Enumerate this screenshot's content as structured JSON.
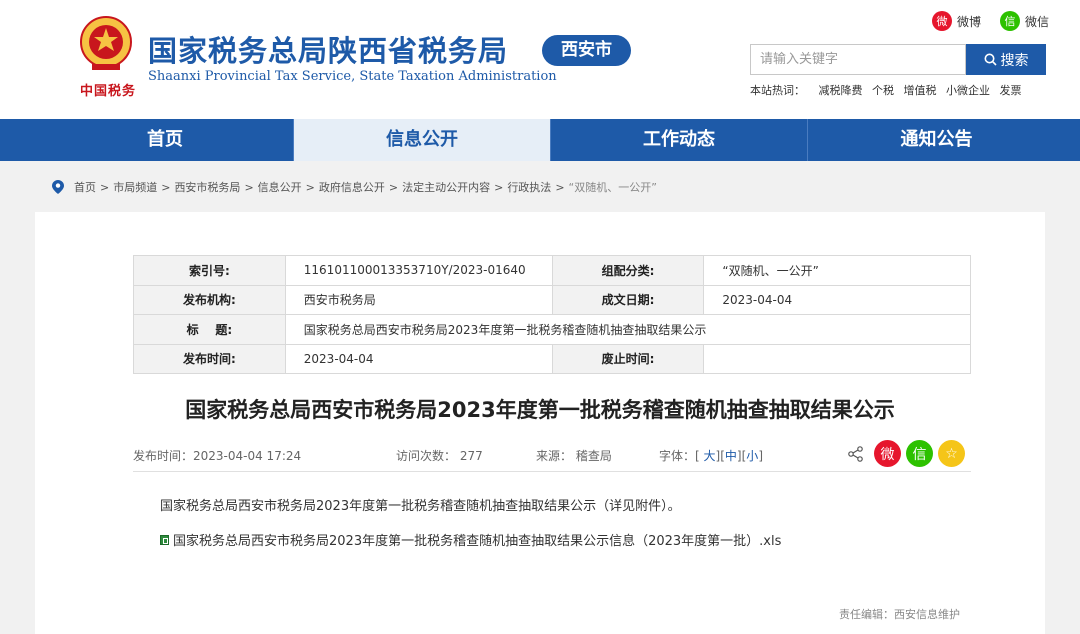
{
  "header": {
    "logo_text": "中国税务",
    "site_title": "国家税务总局陕西省税务局",
    "site_subtitle": "Shaanxi Provincial Tax Service, State Taxation Administration",
    "city_badge": "西安市",
    "social": {
      "weibo": "微博",
      "weixin": "微信"
    },
    "search": {
      "placeholder": "请输入关键字",
      "button": "搜索"
    },
    "hotwords": {
      "label": "本站热词：",
      "items": [
        "减税降费",
        "个税",
        "增值税",
        "小微企业",
        "发票"
      ]
    }
  },
  "nav": {
    "items": [
      "首页",
      "信息公开",
      "工作动态",
      "通知公告"
    ],
    "active_index": 1
  },
  "breadcrumb": [
    "首页",
    "市局频道",
    "西安市税务局",
    "信息公开",
    "政府信息公开",
    "法定主动公开内容",
    "行政执法",
    "“双随机、一公开”"
  ],
  "meta": {
    "index_label": "索引号:",
    "index_value": "116101100013353710Y/2023-01640",
    "category_label": "组配分类:",
    "category_value": "“双随机、一公开”",
    "org_label": "发布机构:",
    "org_value": "西安市税务局",
    "date_label": "成文日期:",
    "date_value": "2023-04-04",
    "title_label": "标    题:",
    "title_value": "国家税务总局西安市税务局2023年度第一批税务稽查随机抽查抽取结果公示",
    "publish_label": "发布时间:",
    "publish_value": "2023-04-04",
    "expire_label": "废止时间:",
    "expire_value": ""
  },
  "article": {
    "title": "国家税务总局西安市税务局2023年度第一批税务稽查随机抽查抽取结果公示",
    "publish_time": "发布时间：2023-04-04 17:24",
    "visits": "访问次数： 277",
    "source": "来源： 稽查局",
    "font_label": "字体：[",
    "font_large": "大",
    "font_medium": "中",
    "font_small": "小",
    "paragraph": "国家税务总局西安市税务局2023年度第一批税务稽查随机抽查抽取结果公示（详见附件）。",
    "attachment": "国家税务总局西安市税务局2023年度第一批税务稽查随机抽查抽取结果公示信息（2023年度第一批）.xls",
    "editor": "责任编辑：西安信息维护"
  },
  "colors": {
    "brand_blue": "#1e5aa8",
    "red": "#c8161d"
  }
}
